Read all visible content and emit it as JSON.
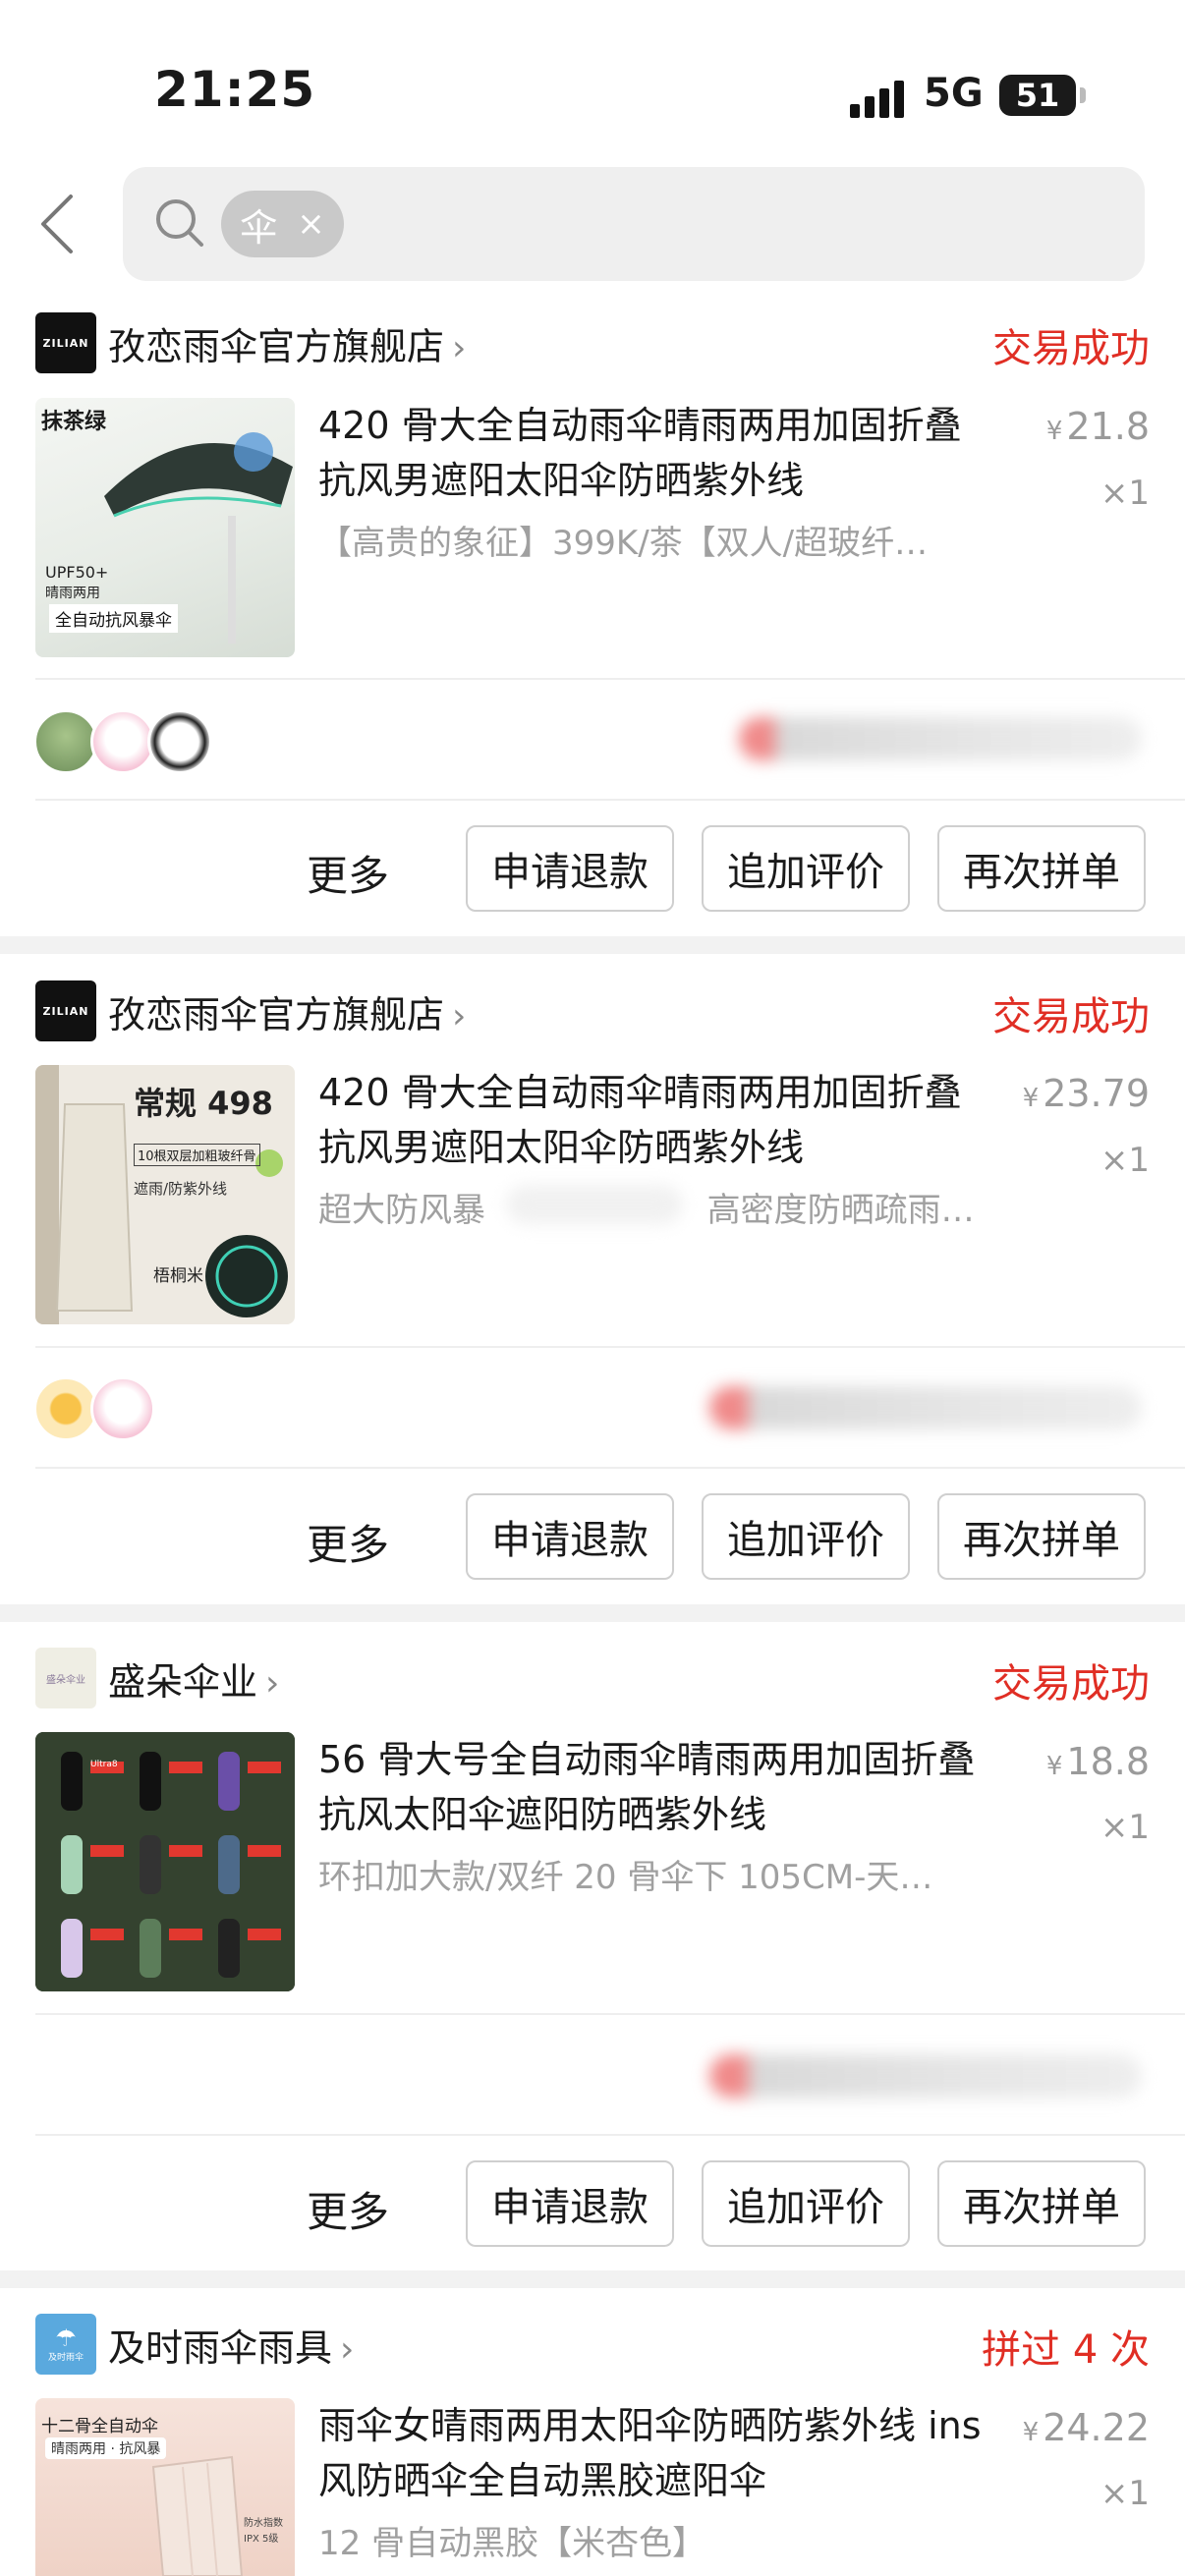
{
  "status_bar": {
    "time": "21:25",
    "network": "5G",
    "battery": "51"
  },
  "search": {
    "chip_text": "伞",
    "chip_close": "×"
  },
  "labels": {
    "more": "更多",
    "refund": "申请退款",
    "review": "追加评价",
    "reorder": "再次拼单",
    "currency": "¥"
  },
  "orders": [
    {
      "shop": "孜恋雨伞官方旗舰店",
      "logo_text": "ZILIAN",
      "status": "交易成功",
      "title": "420 骨大全自动雨伞晴雨两用加固折叠抗风男遮阳太阳伞防晒紫外线",
      "spec": "【高贵的象征】399K/茶【双人/超玻纤…",
      "price": "21.8",
      "qty": "×1",
      "thumb_texts": [
        "抹茶绿",
        "UPF50+",
        "晴雨两用",
        "全自动抗风暴伞"
      ]
    },
    {
      "shop": "孜恋雨伞官方旗舰店",
      "logo_text": "ZILIAN",
      "status": "交易成功",
      "title": "420 骨大全自动雨伞晴雨两用加固折叠抗风男遮阳太阳伞防晒紫外线",
      "spec": "超大防风暴 　　　　　　 高密度防晒疏雨…",
      "price": "23.79",
      "qty": "×1",
      "thumb_texts": [
        "常规 498",
        "10根双层加粗玻纤骨",
        "遮雨/防紫外线",
        "梧桐米"
      ]
    },
    {
      "shop": "盛朵伞业",
      "logo_text": "盛朵伞业",
      "status": "交易成功",
      "title": "56 骨大号全自动雨伞晴雨两用加固折叠抗风太阳伞遮阳防晒紫外线",
      "spec": "环扣加大款/双纤 20 骨伞下 105CM-天…",
      "price": "18.8",
      "qty": "×1",
      "thumb_texts": [
        "Ultra8"
      ]
    },
    {
      "shop": "及时雨伞雨具",
      "logo_text": "及时雨伞",
      "status": "拼过 4 次",
      "title": "雨伞女晴雨两用太阳伞防晒防紫外线 ins 风防晒伞全自动黑胶遮阳伞",
      "spec": "12 骨自动黑胶【米杏色】",
      "price": "24.22",
      "qty": "×1",
      "thumb_texts": [
        "十二骨全自动伞",
        "晴雨两用 · 抗风暴",
        "防水指数",
        "IPX 5级"
      ]
    }
  ]
}
